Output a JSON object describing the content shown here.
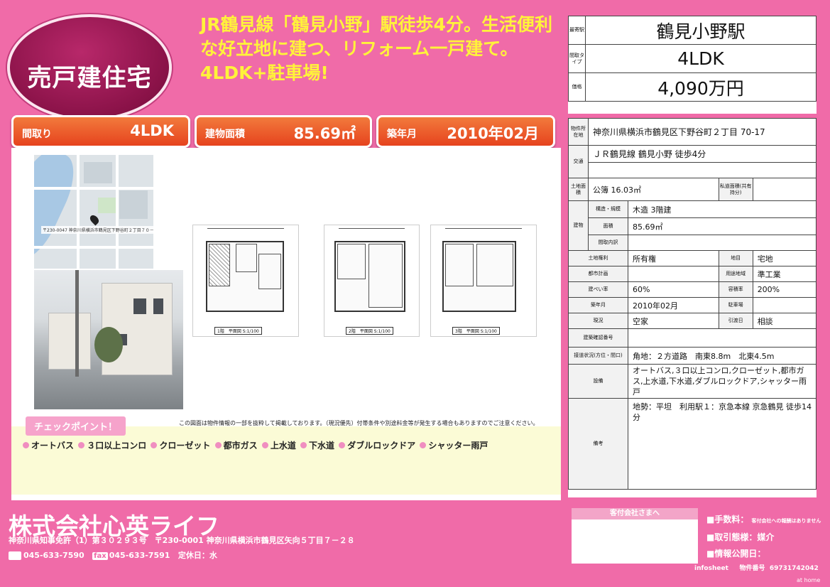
{
  "header": {
    "badge": "売戸建住宅",
    "headline": "JR鶴見線「鶴見小野」駅徒歩4分。生活便利な好立地に建つ、リフォーム一戸建て。4LDK+駐車場!"
  },
  "tabs": [
    {
      "label": "間取り",
      "value": "4LDK"
    },
    {
      "label": "建物面積",
      "value": "85.69㎡"
    },
    {
      "label": "築年月",
      "value": "2010年02月"
    }
  ],
  "summary": {
    "station_label": "最寄駅",
    "station": "鶴見小野駅",
    "layout_label": "間取タイプ",
    "layout": "4LDK",
    "price_label": "価格",
    "price": "4,090万円"
  },
  "details": {
    "location_label": "物件所在地",
    "location": "神奈川県横浜市鶴見区下野谷町２丁目 70-17",
    "transport_label": "交通",
    "transport": "ＪＲ鶴見線 鶴見小野 徒歩4分",
    "land_label": "土地面積",
    "land": "公簿 16.03㎡",
    "private_road_label": "私道面積(共有持分)",
    "building_label": "建物",
    "structure_label": "構造・規模",
    "structure": "木造 3階建",
    "area_label": "面積",
    "area": "85.69㎡",
    "layout_detail_label": "間取内訳",
    "rights_label": "土地権利",
    "rights": "所有権",
    "category_label": "地目",
    "category": "宅地",
    "planning_label": "都市計画",
    "zoning_label": "用途地域",
    "zoning": "準工業",
    "coverage_label": "建ぺい率",
    "coverage": "60%",
    "far_label": "容積率",
    "far": "200%",
    "built_label": "築年月",
    "built": "2010年02月",
    "parking_label": "駐車場",
    "status_label": "現況",
    "status": "空家",
    "handover_label": "引渡日",
    "handover": "相談",
    "confirm_label": "建築確認番号",
    "road_label": "接道状況(方位・間口)",
    "road": "角地：２方道路　南東8.8m　北東4.5m",
    "equipment_label": "設備",
    "equipment": "オートバス,３口以上コンロ,クローゼット,都市ガス,上水道,下水道,ダブルロックドア,シャッター雨戸",
    "remarks_label": "備考",
    "remarks": "地勢：平坦　利用駅１：京急本線 京急鶴見 徒歩14分"
  },
  "map": {
    "address": "〒230-0047 神奈川県横浜市鶴見区下野谷町２丁目７０－１７"
  },
  "plans": [
    {
      "caption": "1階　平面図 S:1/100"
    },
    {
      "caption": "2階　平面図 S:1/100"
    },
    {
      "caption": "3階　平面図 S:1/100"
    }
  ],
  "notice": "この図面は物件情報の一部を抜粋して掲載しております。（現況優先）付帯条件や別途料金等が発生する場合もありますのでご注意ください。",
  "checkpoints": {
    "title": "チェックポイント！",
    "items": [
      "オートバス",
      "３口以上コンロ",
      "クローゼット",
      "都市ガス",
      "上水道",
      "下水道",
      "ダブルロックドア",
      "シャッター雨戸"
    ]
  },
  "footer": {
    "company": "株式会社心英ライフ",
    "license": "神奈川県知事免許（1）第３０２９３号　〒230-0001 神奈川県横浜市鶴見区矢向５丁目７－２８",
    "tel": "045-633-7590",
    "fax_label": "fax",
    "fax": "045-633-7591",
    "holiday": "定休日：水",
    "recipient": "客付会社さまへ",
    "fee_label": "■手数料：",
    "fee_note": "客付会社への報酬はありません",
    "deal_label": "■取引態様：",
    "deal": "媒介",
    "published_label": "■情報公開日：",
    "infosheet": "infosheet",
    "property_no_label": "物件番号",
    "property_no": "69731742042",
    "brand": "at home"
  }
}
